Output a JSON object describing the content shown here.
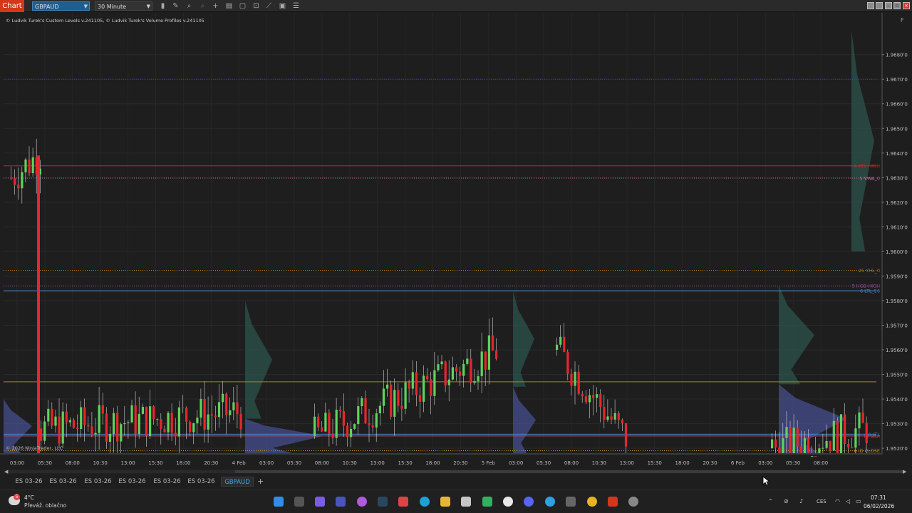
{
  "toolbar": {
    "chart_label": "Chart",
    "instrument": "GBPAUD",
    "interval": "30 Minute",
    "tools": [
      "bar-type-icon",
      "draw-tool-icon",
      "zoom-in-icon",
      "zoom-out-icon",
      "crosshair-icon",
      "properties-icon",
      "templates-icon",
      "fit-icon",
      "strategy-icon",
      "indicators-icon"
    ]
  },
  "chart": {
    "indicator_label": "© Ludvik Turek's Custom Levels v.241105, © Ludvik Turek's Volume Profiles v.241105",
    "watermark": "© 2026 NinjaTrader, LLC",
    "panel_flag": "F",
    "colors": {
      "up": "#5fd35a",
      "down": "#e8262c",
      "bg": "#1e1e1e",
      "profile_blue": "#4e5aa8",
      "profile_green": "#2f5f55"
    }
  },
  "chart_data": {
    "type": "candlestick",
    "instrument": "GBPAUD",
    "interval": "30 Minute",
    "ylim": [
      1.9518,
      1.9697
    ],
    "y_ticks": [
      "1.9680'0",
      "1.9670'0",
      "1.9660'0",
      "1.9650'0",
      "1.9640'0",
      "1.9630'0",
      "1.9620'0",
      "1.9610'0",
      "1.9600'0",
      "1.9590'0",
      "1.9580'0",
      "1.9570'0",
      "1.9560'0",
      "1.9550'0",
      "1.9540'0",
      "1.9530'0",
      "1.9520'0"
    ],
    "x_ticks": [
      "03:00",
      "05:30",
      "08:00",
      "10:30",
      "13:00",
      "15:30",
      "18:00",
      "20:30",
      "4 Feb",
      "03:00",
      "05:30",
      "08:00",
      "10:30",
      "13:00",
      "15:30",
      "18:00",
      "20:30",
      "5 Feb",
      "03:00",
      "05:30",
      "08:00",
      "10:30",
      "13:00",
      "15:30",
      "18:00",
      "20:30",
      "6 Feb",
      "03:00",
      "05:30",
      "08:00"
    ],
    "levels": [
      {
        "label": "",
        "price": 1.967,
        "color": "#3a44a8",
        "style": "dotted"
      },
      {
        "label": "6 ATL HIGH",
        "price": 1.96348,
        "color": "#c8262c",
        "style": "solid"
      },
      {
        "label": "5 VWA_0",
        "price": 1.96298,
        "color": "#c07090",
        "style": "dotted"
      },
      {
        "label": "25 YHL_0",
        "price": 1.95923,
        "color": "#b07820",
        "style": "dotted"
      },
      {
        "label": "5 HGB HIGH",
        "price": 1.9586,
        "color": "#a050a0",
        "style": "dotted"
      },
      {
        "label": "6 LTL_56",
        "price": 1.9584,
        "color": "#4a8ad8",
        "style": "solid"
      },
      {
        "label": "",
        "price": 1.9547,
        "color": "#b08020",
        "style": "solid"
      },
      {
        "label": "6 LTL",
        "price": 1.95257,
        "color": "#4a8ad8",
        "style": "solid"
      },
      {
        "label": "ID VAH",
        "price": 1.9525,
        "color": "#d04060",
        "style": "solid"
      },
      {
        "label": "6 ID CLOSE",
        "price": 1.9519,
        "color": "#c09030",
        "style": "dotted"
      }
    ]
  },
  "scrollbar": {
    "left_arrow": "◀",
    "right_arrow": "▶"
  },
  "tabs": [
    "ES 03-26",
    "ES 03-26",
    "ES 03-26",
    "ES 03-26",
    "ES 03-26",
    "ES 03-26",
    "GBPAUD"
  ],
  "add_tab": "+",
  "taskbar": {
    "weather_temp": "4°C",
    "weather_desc": "Převáž. oblačno",
    "weather_badge": "5",
    "apps": [
      "windows-start-icon",
      "task-view-icon",
      "copilot-icon",
      "teams-icon",
      "media-icon",
      "steam-icon",
      "snipping-icon",
      "edge-icon",
      "file-explorer-icon",
      "store-icon",
      "app-green-icon",
      "location-icon",
      "discord-icon",
      "telegram-icon",
      "calculator-icon",
      "chrome-icon",
      "ninjatrader-icon",
      "chrome-alt-icon"
    ],
    "language": "CES",
    "time": "07:31",
    "date": "06/02/2026"
  }
}
